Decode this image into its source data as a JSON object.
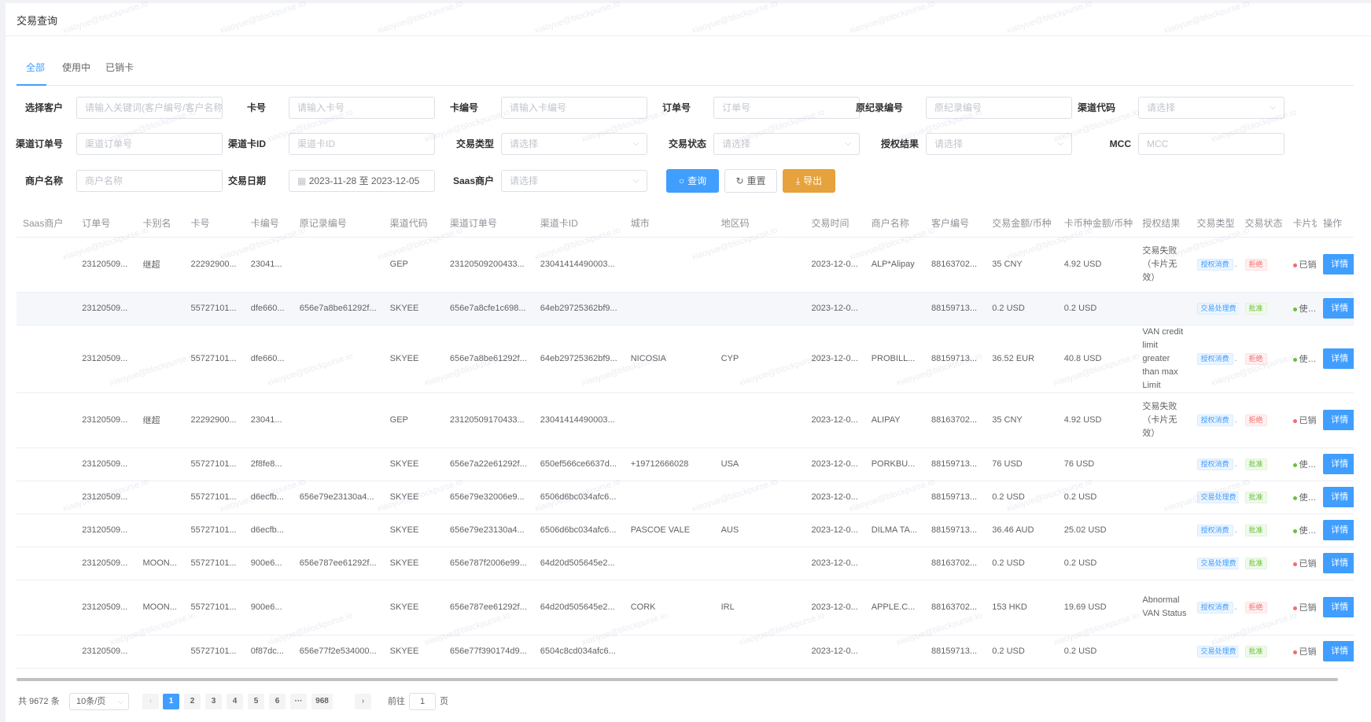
{
  "page_title": "交易查询",
  "tabs": [
    {
      "label": "全部",
      "active": true
    },
    {
      "label": "使用中",
      "active": false
    },
    {
      "label": "已销卡",
      "active": false
    }
  ],
  "filters": {
    "customer": {
      "label": "选择客户",
      "placeholder": "请输入关键词(客户编号/客户名称"
    },
    "card_no": {
      "label": "卡号",
      "placeholder": "请输入卡号"
    },
    "card_code": {
      "label": "卡编号",
      "placeholder": "请输入卡编号"
    },
    "order_no": {
      "label": "订单号",
      "placeholder": "订单号"
    },
    "orig_record": {
      "label": "原纪录编号",
      "placeholder": "原纪录编号"
    },
    "channel_code": {
      "label": "渠道代码",
      "placeholder": "请选择"
    },
    "channel_order": {
      "label": "渠道订单号",
      "placeholder": "渠道订单号"
    },
    "channel_card": {
      "label": "渠道卡ID",
      "placeholder": "渠道卡ID"
    },
    "trade_type": {
      "label": "交易类型",
      "placeholder": "请选择"
    },
    "trade_status": {
      "label": "交易状态",
      "placeholder": "请选择"
    },
    "auth_result": {
      "label": "授权结果",
      "placeholder": "请选择"
    },
    "mcc": {
      "label": "MCC",
      "placeholder": "MCC"
    },
    "merchant": {
      "label": "商户名称",
      "placeholder": "商户名称"
    },
    "trade_date": {
      "label": "交易日期",
      "start": "2023-11-28",
      "sep": "至",
      "end": "2023-12-05"
    },
    "saas": {
      "label": "Saas商户",
      "placeholder": "请选择"
    }
  },
  "buttons": {
    "query": "查询",
    "reset": "重置",
    "export": "导出"
  },
  "columns": [
    "Saas商户",
    "订单号",
    "卡别名",
    "卡号",
    "卡编号",
    "原记录编号",
    "渠道代码",
    "渠道订单号",
    "渠道卡ID",
    "城市",
    "地区码",
    "交易时间",
    "商户名称",
    "客户编号",
    "交易金额/币种",
    "卡币种金额/币种",
    "授权结果",
    "交易类型",
    "交易状态",
    "卡片状",
    "操作"
  ],
  "rows": [
    {
      "saas": "",
      "order": "23120509...",
      "alias": "继超",
      "card": "22292900...",
      "code": "23041...",
      "orig": "",
      "channel": "GEP",
      "ch_order": "23120509200433...",
      "ch_card": "23041414490003...",
      "city": "",
      "region": "",
      "time": "2023-12-0...",
      "merchant": "ALP*Alipay",
      "cust": "88163702...",
      "amount": "35 CNY",
      "card_amount": "4.92 USD",
      "auth": "交易失败（卡片无效）",
      "type": "授权消费",
      "status": "拒绝",
      "status_color": "red",
      "card_state": "已销",
      "card_dot": "red",
      "detail": "详情"
    },
    {
      "saas": "",
      "order": "23120509...",
      "alias": "",
      "card": "55727101...",
      "code": "dfe660...",
      "orig": "656e7a8be61292f...",
      "channel": "SKYEE",
      "ch_order": "656e7a8cfe1c698...",
      "ch_card": "64eb29725362bf9...",
      "city": "",
      "region": "",
      "time": "2023-12-0...",
      "merchant": "",
      "cust": "88159713...",
      "amount": "0.2 USD",
      "card_amount": "0.2 USD",
      "auth": "",
      "type": "交易处理费",
      "status": "批准",
      "status_color": "green",
      "card_state": "使用中",
      "card_dot": "green",
      "detail": "详情"
    },
    {
      "saas": "",
      "order": "23120509...",
      "alias": "",
      "card": "55727101...",
      "code": "dfe660...",
      "orig": "",
      "channel": "SKYEE",
      "ch_order": "656e7a8be61292f...",
      "ch_card": "64eb29725362bf9...",
      "city": "NICOSIA",
      "region": "CYP",
      "time": "2023-12-0...",
      "merchant": "PROBILL...",
      "cust": "88159713...",
      "amount": "36.52 EUR",
      "card_amount": "40.8 USD",
      "auth": "VAN credit limit greater than max Limit",
      "type": "授权消费",
      "status": "拒绝",
      "status_color": "red",
      "card_state": "使用中",
      "card_dot": "green",
      "detail": "详情"
    },
    {
      "saas": "",
      "order": "23120509...",
      "alias": "继超",
      "card": "22292900...",
      "code": "23041...",
      "orig": "",
      "channel": "GEP",
      "ch_order": "23120509170433...",
      "ch_card": "23041414490003...",
      "city": "",
      "region": "",
      "time": "2023-12-0...",
      "merchant": "ALIPAY",
      "cust": "88163702...",
      "amount": "35 CNY",
      "card_amount": "4.92 USD",
      "auth": "交易失败（卡片无效）",
      "type": "授权消费",
      "status": "拒绝",
      "status_color": "red",
      "card_state": "已销",
      "card_dot": "red",
      "detail": "详情"
    },
    {
      "saas": "",
      "order": "23120509...",
      "alias": "",
      "card": "55727101...",
      "code": "2f8fe8...",
      "orig": "",
      "channel": "SKYEE",
      "ch_order": "656e7a22e61292f...",
      "ch_card": "650ef566ce6637d...",
      "city": "+19712666028",
      "region": "USA",
      "time": "2023-12-0...",
      "merchant": "PORKBU...",
      "cust": "88159713...",
      "amount": "76 USD",
      "card_amount": "76 USD",
      "auth": "",
      "type": "授权消费",
      "status": "批准",
      "status_color": "green",
      "card_state": "使用中",
      "card_dot": "green",
      "detail": "详情"
    },
    {
      "saas": "",
      "order": "23120509...",
      "alias": "",
      "card": "55727101...",
      "code": "d6ecfb...",
      "orig": "656e79e23130a4...",
      "channel": "SKYEE",
      "ch_order": "656e79e32006e9...",
      "ch_card": "6506d6bc034afc6...",
      "city": "",
      "region": "",
      "time": "2023-12-0...",
      "merchant": "",
      "cust": "88159713...",
      "amount": "0.2 USD",
      "card_amount": "0.2 USD",
      "auth": "",
      "type": "交易处理费",
      "status": "批准",
      "status_color": "green",
      "card_state": "使用中",
      "card_dot": "green",
      "detail": "详情"
    },
    {
      "saas": "",
      "order": "23120509...",
      "alias": "",
      "card": "55727101...",
      "code": "d6ecfb...",
      "orig": "",
      "channel": "SKYEE",
      "ch_order": "656e79e23130a4...",
      "ch_card": "6506d6bc034afc6...",
      "city": "PASCOE VALE",
      "region": "AUS",
      "time": "2023-12-0...",
      "merchant": "DILMA TA...",
      "cust": "88159713...",
      "amount": "36.46 AUD",
      "card_amount": "25.02 USD",
      "auth": "",
      "type": "授权消费",
      "status": "批准",
      "status_color": "green",
      "card_state": "使用中",
      "card_dot": "green",
      "detail": "详情"
    },
    {
      "saas": "",
      "order": "23120509...",
      "alias": "MOON...",
      "card": "55727101...",
      "code": "900e6...",
      "orig": "656e787ee61292f...",
      "channel": "SKYEE",
      "ch_order": "656e787f2006e99...",
      "ch_card": "64d20d505645e2...",
      "city": "",
      "region": "",
      "time": "2023-12-0...",
      "merchant": "",
      "cust": "88163702...",
      "amount": "0.2 USD",
      "card_amount": "0.2 USD",
      "auth": "",
      "type": "交易处理费",
      "status": "批准",
      "status_color": "green",
      "card_state": "已销",
      "card_dot": "red",
      "detail": "详情"
    },
    {
      "saas": "",
      "order": "23120509...",
      "alias": "MOON...",
      "card": "55727101...",
      "code": "900e6...",
      "orig": "",
      "channel": "SKYEE",
      "ch_order": "656e787ee61292f...",
      "ch_card": "64d20d505645e2...",
      "city": "CORK",
      "region": "IRL",
      "time": "2023-12-0...",
      "merchant": "APPLE.C...",
      "cust": "88163702...",
      "amount": "153 HKD",
      "card_amount": "19.69 USD",
      "auth": "Abnormal VAN Status",
      "type": "授权消费",
      "status": "拒绝",
      "status_color": "red",
      "card_state": "已销",
      "card_dot": "red",
      "detail": "详情"
    },
    {
      "saas": "",
      "order": "23120509...",
      "alias": "",
      "card": "55727101...",
      "code": "0f87dc...",
      "orig": "656e77f2e534000...",
      "channel": "SKYEE",
      "ch_order": "656e77f390174d9...",
      "ch_card": "6504c8cd034afc6...",
      "city": "",
      "region": "",
      "time": "2023-12-0...",
      "merchant": "",
      "cust": "88159713...",
      "amount": "0.2 USD",
      "card_amount": "0.2 USD",
      "auth": "",
      "type": "交易处理费",
      "status": "批准",
      "status_color": "green",
      "card_state": "已销",
      "card_dot": "red",
      "detail": "详情"
    }
  ],
  "pagination": {
    "total": "共 9672 条",
    "page_size": "10条/页",
    "pages": [
      "1",
      "2",
      "3",
      "4",
      "5",
      "6",
      "···",
      "968"
    ],
    "current": "1",
    "goto_prefix": "前往",
    "goto_value": "1",
    "goto_suffix": "页"
  },
  "watermark": "xiaoyue@blockpurse.io",
  "colors": {
    "primary": "#409eff",
    "warning": "#e6a23c",
    "danger": "#f56c6c",
    "success": "#67c23a"
  }
}
